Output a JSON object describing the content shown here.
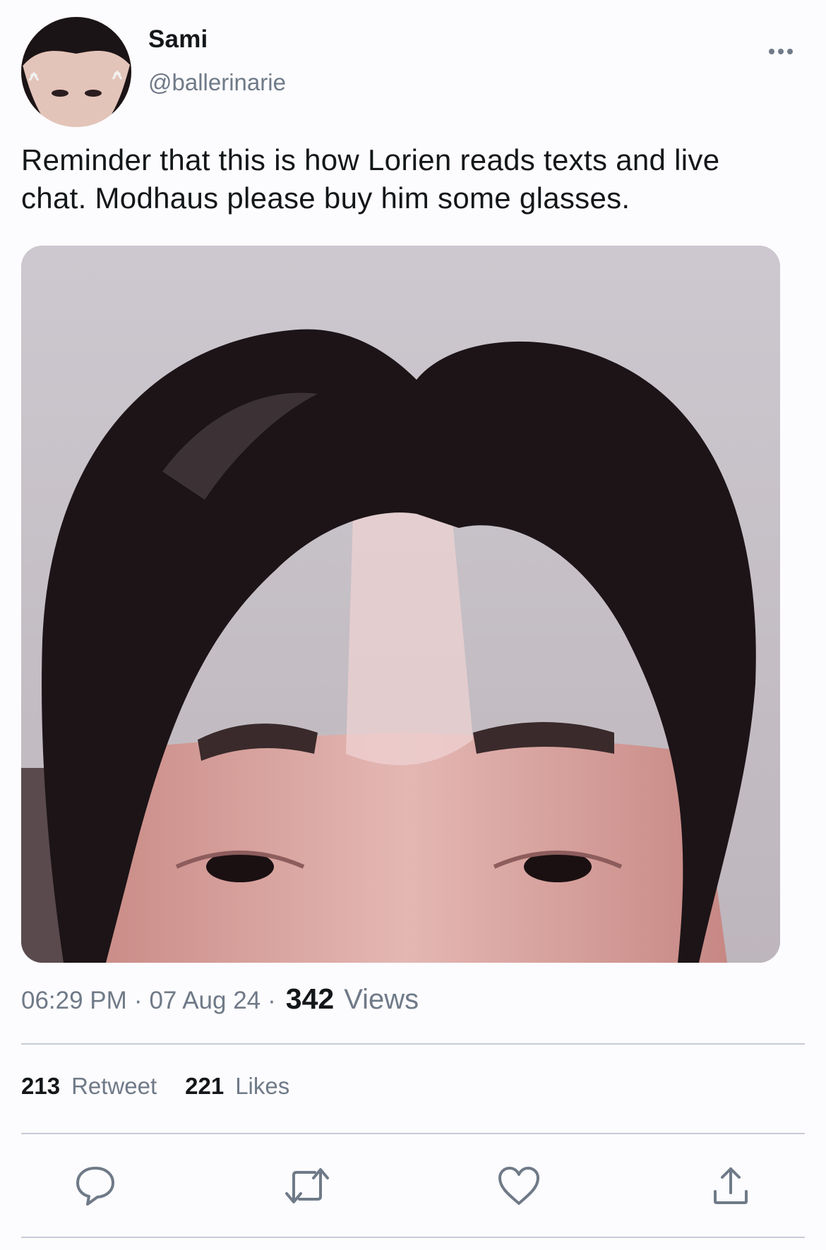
{
  "author": {
    "display_name": "Sami",
    "handle": "@ballerinarie",
    "avatar_icon": "profile-photo"
  },
  "tweet": {
    "text_line1": "Reminder that this is how Lorien reads texts and live",
    "text_line2": "chat. Modhaus please buy him some glasses."
  },
  "meta": {
    "time": "06:29 PM",
    "separator": "·",
    "date": "07 Aug 24",
    "views_count": "342",
    "views_label": "Views"
  },
  "stats": {
    "retweets_count": "213",
    "retweets_label": "Retweet",
    "likes_count": "221",
    "likes_label": "Likes"
  },
  "actions": {
    "reply_icon": "reply-icon",
    "retweet_icon": "retweet-icon",
    "like_icon": "heart-icon",
    "share_icon": "share-icon"
  },
  "colors": {
    "primary_text": "#14171a",
    "secondary_text": "#6f7a88",
    "divider": "#c7ccd6",
    "background": "#fcfbfd"
  }
}
